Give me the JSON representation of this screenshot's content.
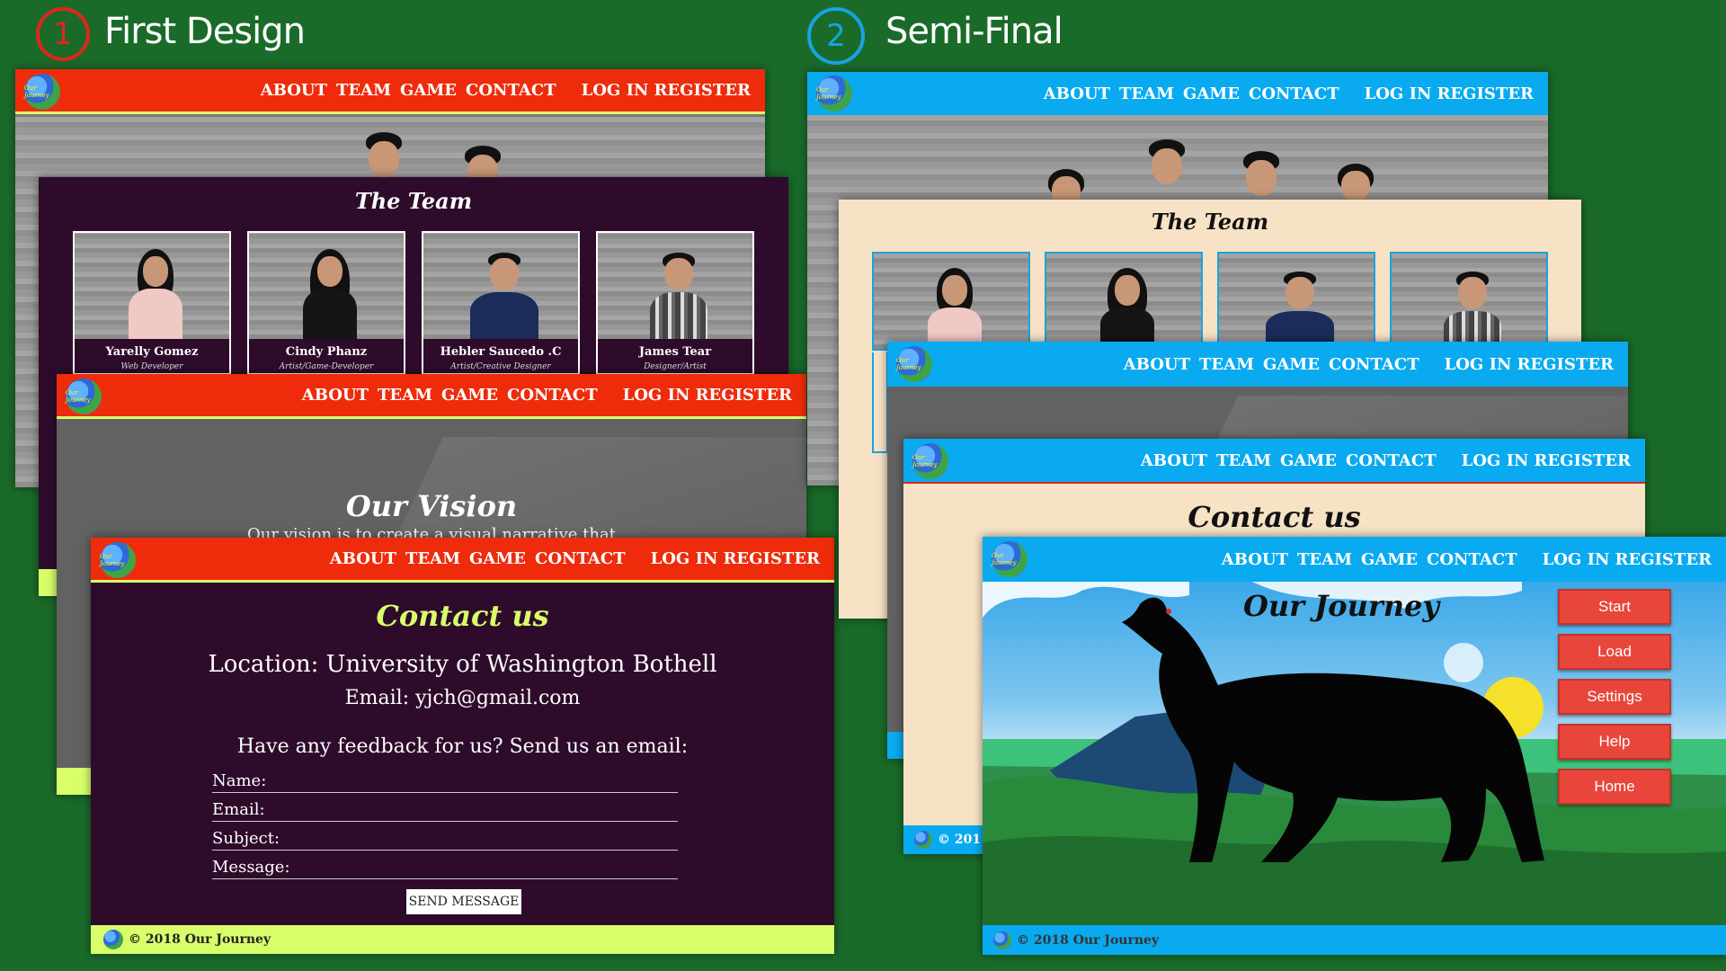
{
  "section1": {
    "number": "1",
    "title": "First Design",
    "color": "#e0261c"
  },
  "section2": {
    "number": "2",
    "title": "Semi-Final",
    "color": "#1aa3e0"
  },
  "nav": {
    "logo_text": "Our Journey",
    "items": [
      "ABOUT",
      "TEAM",
      "GAME",
      "CONTACT"
    ],
    "login": "LOG IN",
    "register": "REGISTER"
  },
  "team": {
    "title": "The Team",
    "members": [
      {
        "name": "Yarelly Gomez",
        "role": "Web Developer"
      },
      {
        "name": "Cindy Phanz",
        "role": "Artist/Game-Developer"
      },
      {
        "name": "Hebler Saucedo .C",
        "role": "Artist/Creative Designer"
      },
      {
        "name": "James Tear",
        "role": "Designer/Artist"
      }
    ]
  },
  "vision": {
    "title": "Our Vision",
    "text": "Our vision is to create a visual narrative that"
  },
  "contact": {
    "title": "Contact us",
    "location": "Location: University of Washington Bothell",
    "email": "Email: yjch@gmail.com",
    "prompt": "Have any feedback for us? Send us an email:",
    "fields": [
      "Name:",
      "Email:",
      "Subject:",
      "Message:"
    ],
    "send_label": "SEND MESSAGE"
  },
  "footer": {
    "copyright": "© 2018 Our Journey",
    "copyright_short": "© 201"
  },
  "game": {
    "title": "Our Journey",
    "menu": [
      "Start",
      "Load",
      "Settings",
      "Help",
      "Home"
    ]
  },
  "colors": {
    "red_nav": "#ee2c0c",
    "blue_nav": "#0aaaf0",
    "dark_purple": "#2e0b2b",
    "peach": "#f7e2c6",
    "lime": "#d8ff6a",
    "bg_green": "#1a6b2a"
  }
}
